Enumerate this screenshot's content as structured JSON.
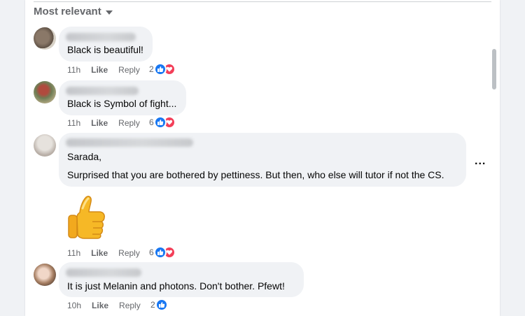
{
  "sort": {
    "label": "Most relevant"
  },
  "comments": [
    {
      "text": "Black is beautiful!",
      "time": "11h",
      "like": "Like",
      "reply": "Reply",
      "reaction_count": "2",
      "reactions": [
        "like",
        "love"
      ]
    },
    {
      "text": "Black is Symbol of fight...",
      "time": "11h",
      "like": "Like",
      "reply": "Reply",
      "reaction_count": "6",
      "reactions": [
        "like",
        "love"
      ]
    },
    {
      "lines": [
        "Sarada,",
        "Surprised that you are bothered by pettiness. But then, who else will tutor if not the CS."
      ],
      "sticker": "thumbs-up",
      "time": "11h",
      "like": "Like",
      "reply": "Reply",
      "reaction_count": "6",
      "reactions": [
        "like",
        "love"
      ],
      "more": "..."
    },
    {
      "text": "It is just Melanin and photons. Don't bother. Pfewt!",
      "time": "10h",
      "like": "Like",
      "reply": "Reply",
      "reaction_count": "2",
      "reactions": [
        "like"
      ]
    }
  ],
  "colors": {
    "like": "#1877f2",
    "love": "#f33e58",
    "bubble": "#f0f2f5",
    "meta": "#65676b"
  }
}
